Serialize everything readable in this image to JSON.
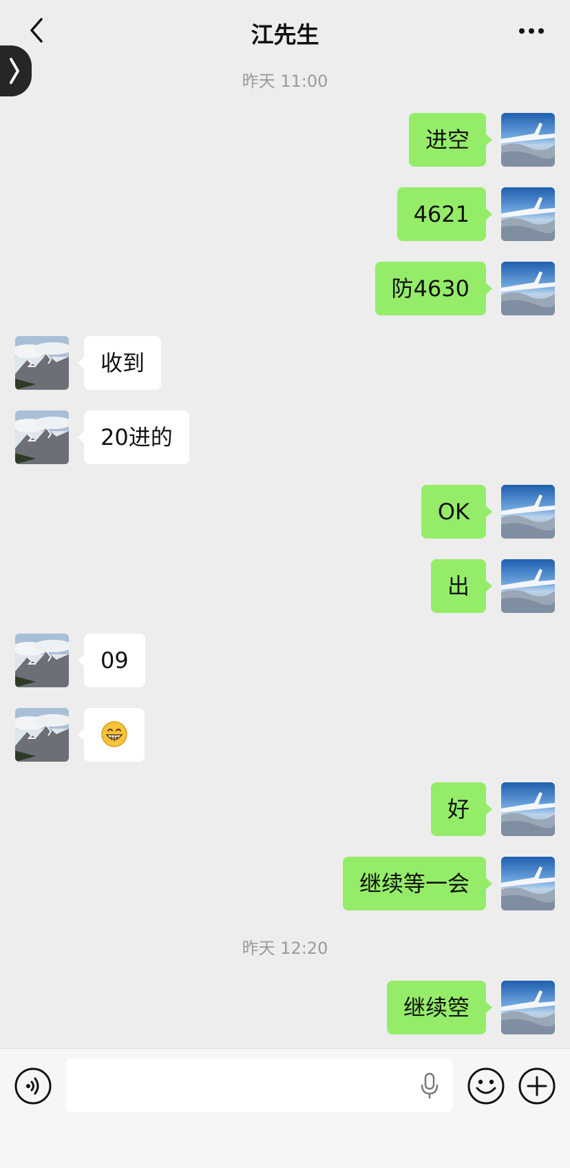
{
  "header": {
    "title": "江先生",
    "back_icon": "chevron-left-icon",
    "more_icon": "more-dots-icon"
  },
  "colors": {
    "background": "#ededed",
    "my_bubble": "#95ec69",
    "their_bubble": "#ffffff",
    "timestamp": "#9a9a9a"
  },
  "timestamps": [
    "昨天 11:00",
    "昨天 12:20"
  ],
  "messages": [
    {
      "sender": "me",
      "text": "进空"
    },
    {
      "sender": "me",
      "text": "4621"
    },
    {
      "sender": "me",
      "text": "防4630"
    },
    {
      "sender": "them",
      "text": "收到"
    },
    {
      "sender": "them",
      "text": "20进的"
    },
    {
      "sender": "me",
      "text": "OK"
    },
    {
      "sender": "me",
      "text": "出"
    },
    {
      "sender": "them",
      "text": "09"
    },
    {
      "sender": "them",
      "text": "",
      "emoji": "grinning-face-emoji"
    },
    {
      "sender": "me",
      "text": "好"
    },
    {
      "sender": "me",
      "text": "继续等一会"
    },
    {
      "sender": "me",
      "text": "继续箜"
    }
  ],
  "avatars": {
    "me": "airplane-wing-sky-avatar",
    "them": "mountain-clouds-avatar"
  },
  "input_bar": {
    "value": "",
    "voice_icon": "voice-toggle-icon",
    "mic_icon": "microphone-icon",
    "emoji_icon": "smiley-icon",
    "plus_icon": "plus-circle-icon"
  }
}
